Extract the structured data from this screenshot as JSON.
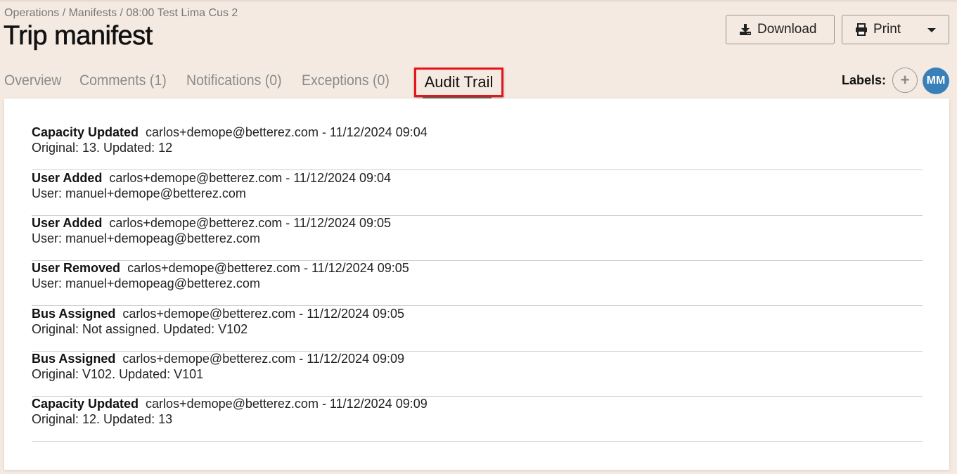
{
  "breadcrumb": "Operations / Manifests / 08:00 Test Lima Cus 2",
  "title": "Trip manifest",
  "toolbar": {
    "download_label": "Download",
    "print_label": "Print"
  },
  "tabs": [
    {
      "label": "Overview"
    },
    {
      "label": "Comments (1)"
    },
    {
      "label": "Notifications (0)"
    },
    {
      "label": "Exceptions (0)"
    },
    {
      "label": "Audit Trail",
      "active": true
    }
  ],
  "labels": {
    "title": "Labels:",
    "add_symbol": "+",
    "avatar_initials": "MM"
  },
  "colors": {
    "highlight": "#e8141b",
    "avatar": "#3a80b8",
    "background": "#f4eae1"
  },
  "audit": [
    {
      "action": "Capacity Updated",
      "meta": "carlos+demope@betterez.com - 11/12/2024 09:04",
      "detail": "Original: 13. Updated: 12"
    },
    {
      "action": "User Added",
      "meta": "carlos+demope@betterez.com - 11/12/2024 09:04",
      "detail": "User: manuel+demope@betterez.com"
    },
    {
      "action": "User Added",
      "meta": "carlos+demope@betterez.com - 11/12/2024 09:05",
      "detail": "User: manuel+demopeag@betterez.com"
    },
    {
      "action": "User Removed",
      "meta": "carlos+demope@betterez.com - 11/12/2024 09:05",
      "detail": "User: manuel+demopeag@betterez.com"
    },
    {
      "action": "Bus Assigned",
      "meta": "carlos+demope@betterez.com - 11/12/2024 09:05",
      "detail": "Original: Not assigned. Updated: V102"
    },
    {
      "action": "Bus Assigned",
      "meta": "carlos+demope@betterez.com - 11/12/2024 09:09",
      "detail": "Original: V102. Updated: V101"
    },
    {
      "action": "Capacity Updated",
      "meta": "carlos+demope@betterez.com - 11/12/2024 09:09",
      "detail": "Original: 12. Updated: 13"
    }
  ]
}
